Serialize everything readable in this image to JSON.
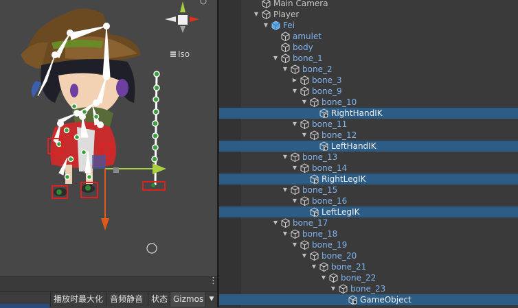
{
  "scene": {
    "projection_label": "Iso",
    "icons": [
      "menu-icon",
      "gizmo-axis-icon",
      "grid-circle-icon"
    ]
  },
  "toolbar": {
    "maximize_on_play": "播放时最大化",
    "mute_audio": "音频静音",
    "stats": "状态",
    "gizmos": "Gizmos",
    "gizmos_dropdown": "▼",
    "more": "⋮"
  },
  "hierarchy": {
    "rows": [
      {
        "depth": 4,
        "arrow": "",
        "label": "Main Camera",
        "color": "grey",
        "selected": false,
        "icon": "cube-icon"
      },
      {
        "depth": 4,
        "arrow": "▼",
        "label": "Player",
        "color": "grey",
        "selected": false,
        "icon": "cube-icon"
      },
      {
        "depth": 5,
        "arrow": "▼",
        "label": "Fei",
        "color": "blue",
        "selected": false,
        "icon": "prefab-icon"
      },
      {
        "depth": 6,
        "arrow": "",
        "label": "amulet",
        "color": "blue",
        "selected": false,
        "icon": "cube-icon"
      },
      {
        "depth": 6,
        "arrow": "",
        "label": "body",
        "color": "blue",
        "selected": false,
        "icon": "cube-icon"
      },
      {
        "depth": 6,
        "arrow": "▼",
        "label": "bone_1",
        "color": "blue",
        "selected": false,
        "icon": "cube-icon"
      },
      {
        "depth": 7,
        "arrow": "▼",
        "label": "bone_2",
        "color": "blue",
        "selected": false,
        "icon": "cube-icon"
      },
      {
        "depth": 8,
        "arrow": "▶",
        "label": "bone_3",
        "color": "blue",
        "selected": false,
        "icon": "cube-icon"
      },
      {
        "depth": 8,
        "arrow": "▼",
        "label": "bone_9",
        "color": "blue",
        "selected": false,
        "icon": "cube-icon"
      },
      {
        "depth": 9,
        "arrow": "▼",
        "label": "bone_10",
        "color": "blue",
        "selected": false,
        "icon": "cube-icon"
      },
      {
        "depth": 10,
        "arrow": "",
        "label": "RightHandIK",
        "color": "white",
        "selected": true,
        "icon": "ik-cube-icon"
      },
      {
        "depth": 8,
        "arrow": "▼",
        "label": "bone_11",
        "color": "blue",
        "selected": false,
        "icon": "cube-icon"
      },
      {
        "depth": 9,
        "arrow": "▼",
        "label": "bone_12",
        "color": "blue",
        "selected": false,
        "icon": "cube-icon"
      },
      {
        "depth": 10,
        "arrow": "",
        "label": "LeftHandIK",
        "color": "white",
        "selected": true,
        "icon": "ik-cube-icon"
      },
      {
        "depth": 7,
        "arrow": "▼",
        "label": "bone_13",
        "color": "blue",
        "selected": false,
        "icon": "cube-icon"
      },
      {
        "depth": 8,
        "arrow": "▼",
        "label": "bone_14",
        "color": "blue",
        "selected": false,
        "icon": "cube-icon"
      },
      {
        "depth": 9,
        "arrow": "",
        "label": "RightLegIK",
        "color": "white",
        "selected": true,
        "icon": "ik-cube-icon"
      },
      {
        "depth": 7,
        "arrow": "▼",
        "label": "bone_15",
        "color": "blue",
        "selected": false,
        "icon": "cube-icon"
      },
      {
        "depth": 8,
        "arrow": "▼",
        "label": "bone_16",
        "color": "blue",
        "selected": false,
        "icon": "cube-icon"
      },
      {
        "depth": 9,
        "arrow": "",
        "label": "LeftLegIK",
        "color": "white",
        "selected": true,
        "icon": "ik-cube-icon"
      },
      {
        "depth": 6,
        "arrow": "▼",
        "label": "bone_17",
        "color": "blue",
        "selected": false,
        "icon": "cube-icon"
      },
      {
        "depth": 7,
        "arrow": "▼",
        "label": "bone_18",
        "color": "blue",
        "selected": false,
        "icon": "cube-icon"
      },
      {
        "depth": 8,
        "arrow": "▼",
        "label": "bone_19",
        "color": "blue",
        "selected": false,
        "icon": "cube-icon"
      },
      {
        "depth": 9,
        "arrow": "▼",
        "label": "bone_20",
        "color": "blue",
        "selected": false,
        "icon": "cube-icon"
      },
      {
        "depth": 10,
        "arrow": "▼",
        "label": "bone_21",
        "color": "blue",
        "selected": false,
        "icon": "cube-icon"
      },
      {
        "depth": 11,
        "arrow": "▼",
        "label": "bone_22",
        "color": "blue",
        "selected": false,
        "icon": "cube-icon"
      },
      {
        "depth": 12,
        "arrow": "▼",
        "label": "bone_23",
        "color": "blue",
        "selected": false,
        "icon": "cube-icon"
      },
      {
        "depth": 13,
        "arrow": "",
        "label": "GameObject",
        "color": "white",
        "selected": true,
        "icon": "ik-cube-icon"
      }
    ]
  },
  "colors": {
    "selection": "#2c5d87",
    "prefab_text": "#7fb4f0",
    "scene_bg": "#474747",
    "panel_bg": "#3a3a3a"
  }
}
